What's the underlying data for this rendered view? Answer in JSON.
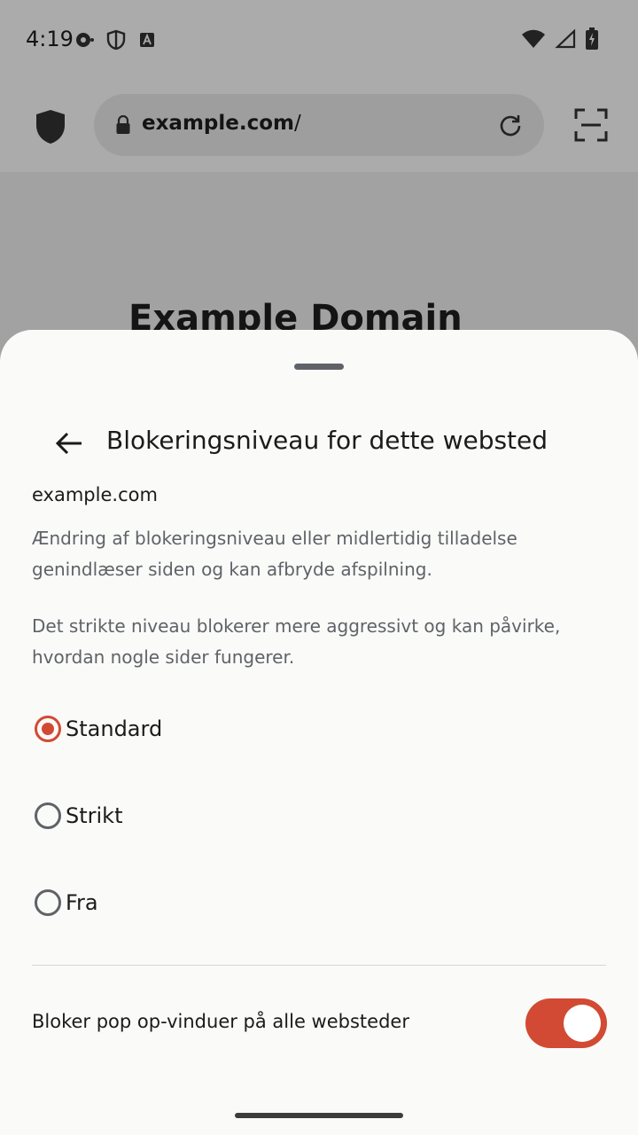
{
  "status_bar": {
    "time": "4:19"
  },
  "browser": {
    "url_host": "example.com",
    "url_path": "/",
    "page_heading": "Example Domain"
  },
  "sheet": {
    "title": "Blokeringsniveau for dette websted",
    "site": "example.com",
    "description1": "Ændring af blokeringsniveau eller midlertidig tilladelse genindlæser siden og kan afbryde afspilning.",
    "description2": "Det strikte niveau blokerer mere aggressivt og kan påvirke, hvordan nogle sider fungerer.",
    "options": [
      {
        "label": "Standard",
        "selected": true
      },
      {
        "label": "Strikt",
        "selected": false
      },
      {
        "label": "Fra",
        "selected": false
      }
    ],
    "popup_toggle": {
      "label": "Bloker pop op-vinduer på alle websteder",
      "on": true
    }
  },
  "colors": {
    "accent": "#d24a33",
    "sheet_bg": "#fafaf8",
    "text": "#1b1b1b",
    "secondary_text": "#5f6368"
  }
}
